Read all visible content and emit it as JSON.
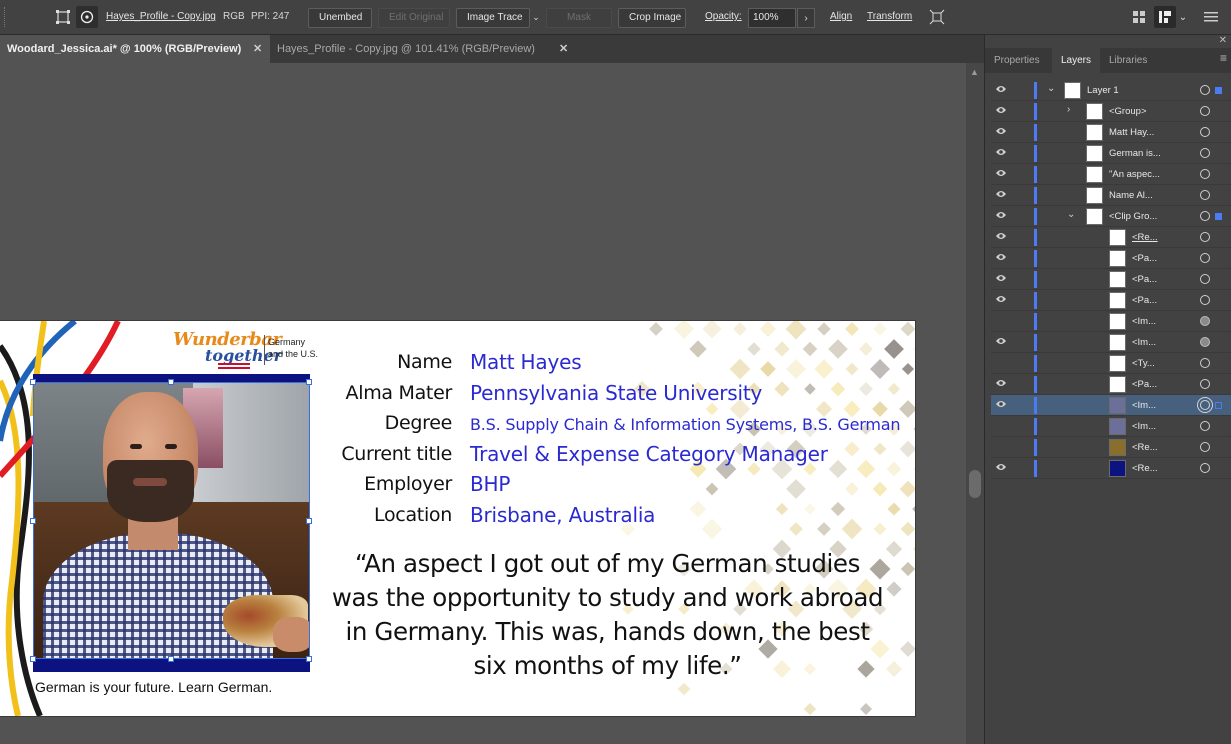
{
  "controlbar": {
    "filename": "Hayes_Profile - Copy.jpg",
    "color_mode": "RGB",
    "ppi": "PPI: 247",
    "unembed": "Unembed",
    "edit_original": "Edit Original",
    "image_trace": "Image Trace",
    "mask": "Mask",
    "crop_image": "Crop Image",
    "opacity_label": "Opacity:",
    "opacity_value": "100%",
    "align": "Align",
    "transform": "Transform"
  },
  "tabs": [
    {
      "label": "Woodard_Jessica.ai* @ 100% (RGB/Preview)",
      "active": true
    },
    {
      "label": "Hayes_Profile - Copy.jpg @ 101.41% (RGB/Preview)",
      "active": false
    }
  ],
  "artboard": {
    "logo_line1": "Wunderbar",
    "logo_line2": "together",
    "logo_sub": "Germany\nand the U.S.",
    "fields": [
      {
        "label": "Name",
        "value": "Matt Hayes",
        "small": false
      },
      {
        "label": "Alma Mater",
        "value": "Pennsylvania State University",
        "small": false
      },
      {
        "label": "Degree",
        "value": "B.S. Supply Chain & Information Systems, B.S. German",
        "small": true
      },
      {
        "label": "Current title",
        "value": "Travel & Expense Category Manager",
        "small": false
      },
      {
        "label": "Employer",
        "value": "BHP",
        "small": false
      },
      {
        "label": "Location",
        "value": "Brisbane, Australia",
        "small": false
      }
    ],
    "quote": "“An aspect I got out of my German studies was the opportunity to study and work abroad in Germany. This was, hands down, the best six months of my life.”",
    "caption": "German is your future. Learn German."
  },
  "panel": {
    "tabs": [
      "Properties",
      "Layers",
      "Libraries"
    ],
    "active_tab": "Layers",
    "layers": [
      {
        "name": "Layer 1",
        "indent": 0,
        "twirl": "open",
        "visible": true,
        "target": "open",
        "selsq": "filled",
        "selected": false
      },
      {
        "name": "<Group>",
        "indent": 1,
        "twirl": "closed",
        "visible": true,
        "target": "open",
        "selsq": "",
        "selected": false
      },
      {
        "name": "Matt Hay...",
        "indent": 1,
        "twirl": "",
        "visible": true,
        "target": "open",
        "selsq": "",
        "selected": false
      },
      {
        "name": "German is...",
        "indent": 1,
        "twirl": "",
        "visible": true,
        "target": "open",
        "selsq": "",
        "selected": false
      },
      {
        "name": "\"An aspec...",
        "indent": 1,
        "twirl": "",
        "visible": true,
        "target": "open",
        "selsq": "",
        "selected": false
      },
      {
        "name": "Name Al...",
        "indent": 1,
        "twirl": "",
        "visible": true,
        "target": "open",
        "selsq": "",
        "selected": false
      },
      {
        "name": "<Clip Gro...",
        "indent": 1,
        "twirl": "open",
        "visible": true,
        "target": "open",
        "selsq": "filled",
        "selected": false
      },
      {
        "name": "<Re...",
        "indent": 2,
        "twirl": "",
        "visible": true,
        "target": "open",
        "selsq": "",
        "selected": false,
        "underline": true
      },
      {
        "name": "<Pa...",
        "indent": 2,
        "twirl": "",
        "visible": true,
        "target": "open",
        "selsq": "",
        "selected": false
      },
      {
        "name": "<Pa...",
        "indent": 2,
        "twirl": "",
        "visible": true,
        "target": "open",
        "selsq": "",
        "selected": false
      },
      {
        "name": "<Pa...",
        "indent": 2,
        "twirl": "",
        "visible": true,
        "target": "open",
        "selsq": "",
        "selected": false
      },
      {
        "name": "<Im...",
        "indent": 2,
        "twirl": "",
        "visible": false,
        "target": "filled",
        "selsq": "",
        "selected": false
      },
      {
        "name": "<Im...",
        "indent": 2,
        "twirl": "",
        "visible": true,
        "target": "filled",
        "selsq": "",
        "selected": false
      },
      {
        "name": "<Ty...",
        "indent": 2,
        "twirl": "",
        "visible": false,
        "target": "open",
        "selsq": "",
        "selected": false
      },
      {
        "name": "<Pa...",
        "indent": 2,
        "twirl": "",
        "visible": true,
        "target": "open",
        "selsq": "",
        "selected": false
      },
      {
        "name": "<Im...",
        "indent": 2,
        "twirl": "",
        "visible": true,
        "target": "sel",
        "selsq": "outline",
        "selected": true
      },
      {
        "name": "<Im...",
        "indent": 2,
        "twirl": "",
        "visible": false,
        "target": "open",
        "selsq": "",
        "selected": false
      },
      {
        "name": "<Re...",
        "indent": 2,
        "twirl": "",
        "visible": false,
        "target": "open",
        "selsq": "",
        "selected": false
      },
      {
        "name": "<Re...",
        "indent": 2,
        "twirl": "",
        "visible": true,
        "target": "open",
        "selsq": "",
        "selected": false
      }
    ]
  },
  "colors": {
    "accent_blue": "#2b2ad1",
    "frame_navy": "#0c1380",
    "selection": "#3b6fd6",
    "layer_color": "#4c7cf3"
  }
}
